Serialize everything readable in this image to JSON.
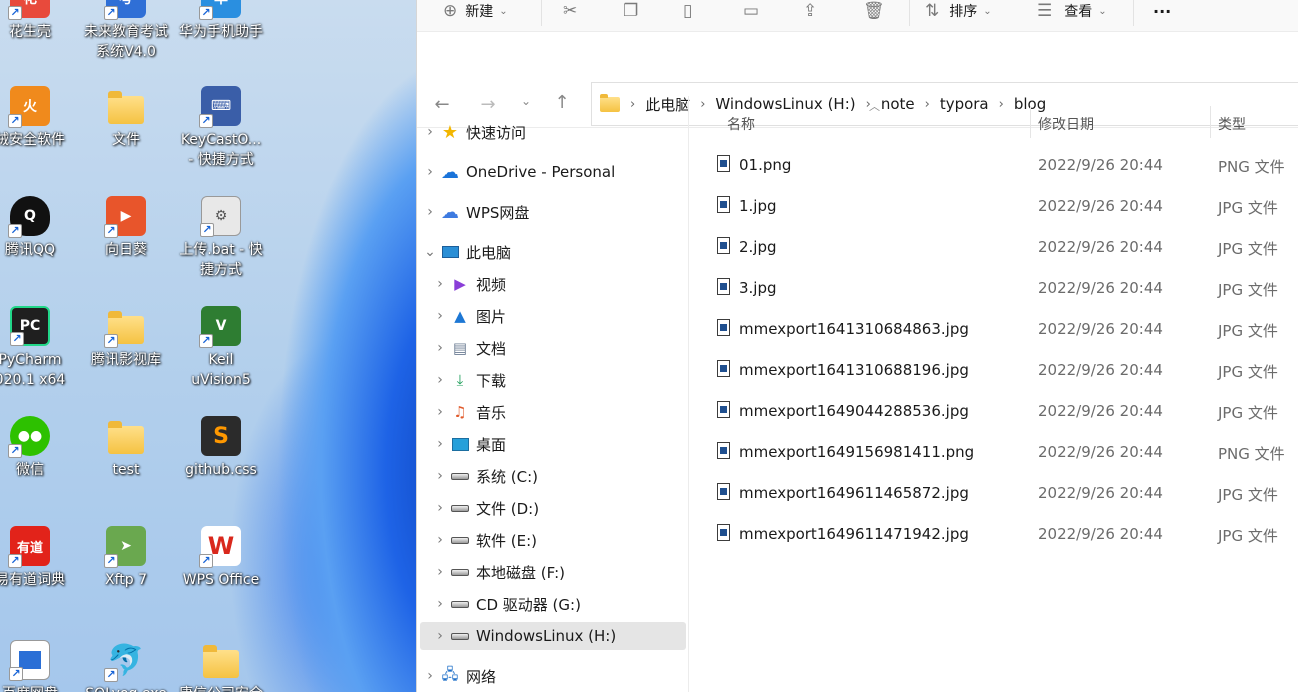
{
  "desktop": {
    "icons": [
      {
        "label1": "花生壳",
        "label2": "",
        "icon": "peanut-shell-icon",
        "color": "#e84a3c"
      },
      {
        "label1": "未来教育考试",
        "label2": "系统V4.0",
        "icon": "exam-system-icon",
        "color": "#2f6fd6"
      },
      {
        "label1": "华为手机助手",
        "label2": "",
        "icon": "huawei-assistant-icon",
        "color": "#2a8fe0"
      },
      {
        "label1": "绒安全软件",
        "label2": "",
        "icon": "huorong-security-icon",
        "color": "#f08a1c"
      },
      {
        "label1": "文件",
        "label2": "",
        "icon": "folder-icon",
        "color": "#f5c242"
      },
      {
        "label1": "KeyCastO...",
        "label2": "- 快捷方式",
        "icon": "keycast-icon",
        "color": "#3a5ea8"
      },
      {
        "label1": "腾讯QQ",
        "label2": "",
        "icon": "qq-icon",
        "color": "#111111"
      },
      {
        "label1": "向日葵",
        "label2": "",
        "icon": "sunlogin-icon",
        "color": "#e8552b"
      },
      {
        "label1": "上传.bat - 快",
        "label2": "捷方式",
        "icon": "batch-gear-icon",
        "color": "#8a8a8a"
      },
      {
        "label1": "PyCharm",
        "label2": "020.1 x64",
        "icon": "pycharm-icon",
        "color": "#1f1f1f"
      },
      {
        "label1": "腾讯影视库",
        "label2": "",
        "icon": "tencent-video-library-icon",
        "color": "#f5c242"
      },
      {
        "label1": "Keil",
        "label2": "uVision5",
        "icon": "keil-icon",
        "color": "#2e7d32"
      },
      {
        "label1": "微信",
        "label2": "",
        "icon": "wechat-icon",
        "color": "#2dc100"
      },
      {
        "label1": "test",
        "label2": "",
        "icon": "folder-icon",
        "color": "#f5c242"
      },
      {
        "label1": "github.css",
        "label2": "",
        "icon": "sublime-text-icon",
        "color": "#2b2b2b"
      },
      {
        "label1": "易有道词典",
        "label2": "",
        "icon": "youdao-dict-icon",
        "color": "#e2231a"
      },
      {
        "label1": "Xftp 7",
        "label2": "",
        "icon": "xftp-icon",
        "color": "#6aa84f"
      },
      {
        "label1": "WPS Office",
        "label2": "",
        "icon": "wps-office-icon",
        "color": "#d9281c"
      },
      {
        "label1": "百度网盘",
        "label2": "",
        "icon": "app-window-icon",
        "color": "#2a6fd6"
      },
      {
        "label1": "SQLyog.exe",
        "label2": "",
        "icon": "sqlyog-dolphin-icon",
        "color": "#1d7fd0"
      },
      {
        "label1": "康信公司安全",
        "label2": "",
        "icon": "folder-icon",
        "color": "#f5c242"
      }
    ]
  },
  "toolbar": {
    "new_label": "新建",
    "sort_label": "排序",
    "view_label": "查看",
    "more_label": "···"
  },
  "address": {
    "crumbs": [
      "此电脑",
      "WindowsLinux (H:)",
      "note",
      "typora",
      "blog"
    ]
  },
  "nav": {
    "quick_access": "快速访问",
    "onedrive": "OneDrive - Personal",
    "wps": "WPS网盘",
    "this_pc": "此电脑",
    "videos": "视频",
    "pictures": "图片",
    "documents": "文档",
    "downloads": "下载",
    "music": "音乐",
    "desktop": "桌面",
    "drive_c": "系统 (C:)",
    "drive_d": "文件 (D:)",
    "drive_e": "软件 (E:)",
    "drive_f": "本地磁盘 (F:)",
    "drive_g": "CD 驱动器 (G:)",
    "drive_h": "WindowsLinux (H:)",
    "network": "网络"
  },
  "columns": {
    "name": "名称",
    "date": "修改日期",
    "type": "类型"
  },
  "files": [
    {
      "name": "01.png",
      "date": "2022/9/26 20:44",
      "type": "PNG 文件"
    },
    {
      "name": "1.jpg",
      "date": "2022/9/26 20:44",
      "type": "JPG 文件"
    },
    {
      "name": "2.jpg",
      "date": "2022/9/26 20:44",
      "type": "JPG 文件"
    },
    {
      "name": "3.jpg",
      "date": "2022/9/26 20:44",
      "type": "JPG 文件"
    },
    {
      "name": "mmexport1641310684863.jpg",
      "date": "2022/9/26 20:44",
      "type": "JPG 文件"
    },
    {
      "name": "mmexport1641310688196.jpg",
      "date": "2022/9/26 20:44",
      "type": "JPG 文件"
    },
    {
      "name": "mmexport1649044288536.jpg",
      "date": "2022/9/26 20:44",
      "type": "JPG 文件"
    },
    {
      "name": "mmexport1649156981411.png",
      "date": "2022/9/26 20:44",
      "type": "PNG 文件"
    },
    {
      "name": "mmexport1649611465872.jpg",
      "date": "2022/9/26 20:44",
      "type": "JPG 文件"
    },
    {
      "name": "mmexport1649611471942.jpg",
      "date": "2022/9/26 20:44",
      "type": "JPG 文件"
    }
  ]
}
